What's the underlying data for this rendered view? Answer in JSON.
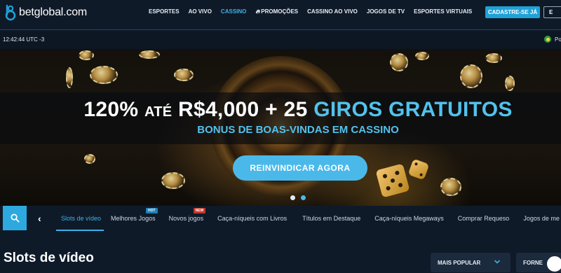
{
  "brand": {
    "name": "betglobal.com",
    "accent": "#20a2d8"
  },
  "nav": {
    "links": [
      {
        "label": "ESPORTES",
        "active": false
      },
      {
        "label": "AO VIVO",
        "active": false
      },
      {
        "label": "CASSINO",
        "active": true
      },
      {
        "label": "PROMOÇÕES",
        "active": false,
        "icon": "flame-icon"
      },
      {
        "label": "CASSINO AO VIVO",
        "active": false
      },
      {
        "label": "JOGOS DE TV",
        "active": false
      },
      {
        "label": "ESPORTES VIRTUAIS",
        "active": false
      }
    ],
    "signup_label": "CADASTRE-SE JÁ",
    "login_label": "E"
  },
  "subbar": {
    "clock": "12:42:44 UTC -3",
    "language": "Po"
  },
  "banner": {
    "headline_a": "120%",
    "headline_b": "ATÉ",
    "headline_c": "R$4,000 + 25",
    "headline_d": "GIROS GRATUITOS",
    "subheadline": "BONUS DE BOAS-VINDAS EM CASSINO",
    "cta_label": "REINVINDICAR AGORA",
    "slide_count": 2,
    "active_slide": 1
  },
  "categories": {
    "items": [
      {
        "label": "Slots de vídeo",
        "active": true
      },
      {
        "label": "Melhores Jogos",
        "tag": "HOT"
      },
      {
        "label": "Novos jogos",
        "tag": "NEW"
      },
      {
        "label": "Caça-níqueis com Livros"
      },
      {
        "label": "Títulos em Destaque"
      },
      {
        "label": "Caça-níqueis Megaways"
      },
      {
        "label": "Comprar Requeso"
      },
      {
        "label": "Jogos de me"
      }
    ]
  },
  "section": {
    "title": "Slots de vídeo",
    "sort_value": "MAIS POPULAR",
    "provider_label": "FORNE"
  }
}
